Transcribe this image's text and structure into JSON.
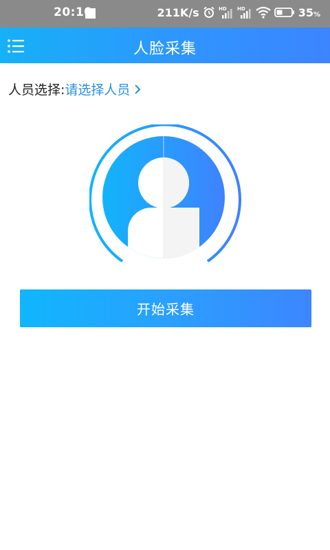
{
  "status_bar": {
    "time": "20:10",
    "net_speed": "211K/s",
    "battery_percent": "35",
    "battery_unit": "%"
  },
  "app_bar": {
    "title": "人脸采集"
  },
  "person_select": {
    "label": "人员选择:",
    "placeholder": "请选择人员"
  },
  "actions": {
    "start_label": "开始采集"
  },
  "colors": {
    "primary": "#2f95ff",
    "accent_light": "#16b1f6",
    "link": "#2a8fe0"
  }
}
